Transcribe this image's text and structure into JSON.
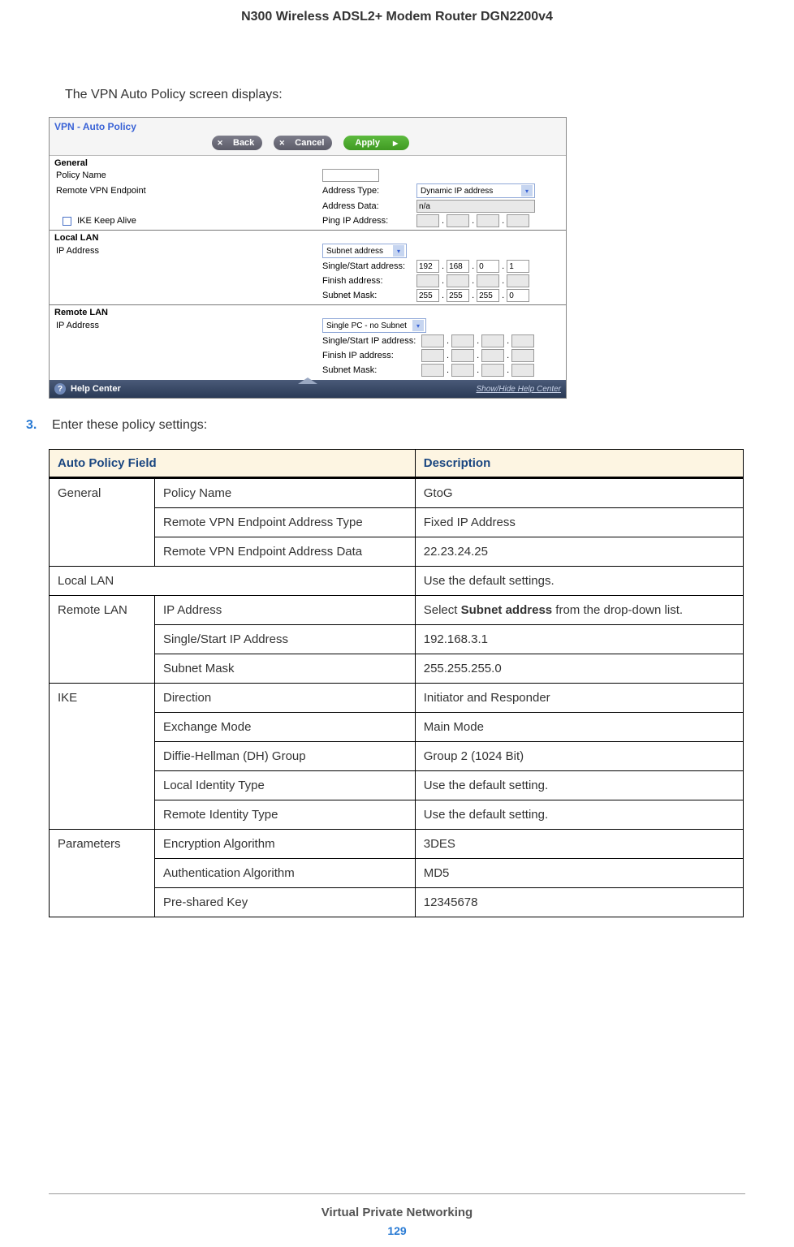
{
  "header": "N300 Wireless ADSL2+ Modem Router DGN2200v4",
  "intro": "The VPN Auto Policy screen displays:",
  "screenshot": {
    "title": "VPN - Auto Policy",
    "buttons": {
      "back": "Back",
      "cancel": "Cancel",
      "apply": "Apply"
    },
    "general": {
      "hdr": "General",
      "policy_name_lbl": "Policy Name",
      "remote_vpn_lbl": "Remote VPN Endpoint",
      "addr_type_lbl": "Address Type:",
      "addr_type_val": "Dynamic IP address",
      "addr_data_lbl": "Address Data:",
      "addr_data_val": "n/a",
      "ike_keep": "IKE Keep Alive",
      "ping_lbl": "Ping IP Address:"
    },
    "local_lan": {
      "hdr": "Local LAN",
      "ip_lbl": "IP Address",
      "select_val": "Subnet address",
      "single_lbl": "Single/Start address:",
      "single_vals": [
        "192",
        "168",
        "0",
        "1"
      ],
      "finish_lbl": "Finish address:",
      "mask_lbl": "Subnet Mask:",
      "mask_vals": [
        "255",
        "255",
        "255",
        "0"
      ]
    },
    "remote_lan": {
      "hdr": "Remote LAN",
      "ip_lbl": "IP Address",
      "select_val": "Single PC - no Subnet",
      "single_lbl": "Single/Start IP address:",
      "finish_lbl": "Finish IP address:",
      "mask_lbl": "Subnet Mask:"
    },
    "help": {
      "label": "Help Center",
      "link": "Show/Hide Help Center"
    }
  },
  "step": {
    "num": "3.",
    "text": "Enter these policy settings:"
  },
  "table": {
    "headers": [
      "Auto Policy Field",
      "Description"
    ],
    "rows": [
      {
        "group": "General",
        "field": "Policy Name",
        "desc": "GtoG",
        "rowspan": 3
      },
      {
        "field": "Remote VPN Endpoint Address Type",
        "desc": "Fixed IP Address"
      },
      {
        "field": "Remote VPN Endpoint Address Data",
        "desc": "22.23.24.25"
      },
      {
        "group_span": "Local LAN",
        "desc": "Use the default settings."
      },
      {
        "group": "Remote LAN",
        "field": "IP Address",
        "desc_pre": "Select ",
        "desc_bold": "Subnet address",
        "desc_post": " from the drop-down list.",
        "rowspan": 3
      },
      {
        "field": "Single/Start IP Address",
        "desc": "192.168.3.1"
      },
      {
        "field": "Subnet Mask",
        "desc": "255.255.255.0"
      },
      {
        "group": "IKE",
        "field": "Direction",
        "desc": "Initiator and Responder",
        "rowspan": 5
      },
      {
        "field": "Exchange Mode",
        "desc": "Main Mode"
      },
      {
        "field": "Diffie-Hellman (DH) Group",
        "desc": "Group 2 (1024 Bit)"
      },
      {
        "field": "Local Identity Type",
        "desc": "Use the default setting."
      },
      {
        "field": "Remote Identity Type",
        "desc": "Use the default setting."
      },
      {
        "group": "Parameters",
        "field": "Encryption Algorithm",
        "desc": "3DES",
        "rowspan": 3
      },
      {
        "field": "Authentication Algorithm",
        "desc": "MD5"
      },
      {
        "field": "Pre-shared Key",
        "desc": "12345678"
      }
    ]
  },
  "footer": {
    "title": "Virtual Private Networking",
    "page": "129"
  }
}
